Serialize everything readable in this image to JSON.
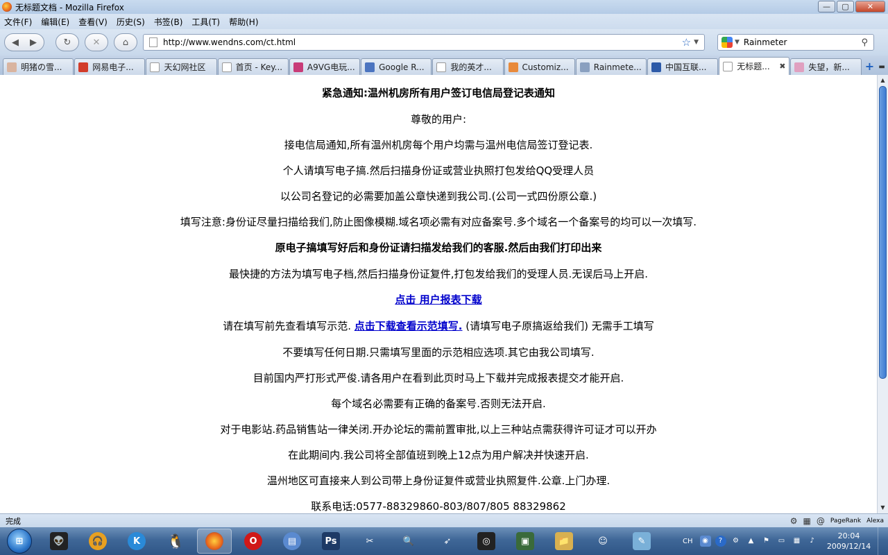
{
  "window": {
    "title": "无标题文档 - Mozilla Firefox",
    "minimize": "—",
    "maximize": "▢",
    "close": "✕"
  },
  "menubar": {
    "items": [
      "文件(F)",
      "编辑(E)",
      "查看(V)",
      "历史(S)",
      "书签(B)",
      "工具(T)",
      "帮助(H)"
    ]
  },
  "toolbar": {
    "back": "◀",
    "forward": "▶",
    "reload": "↻",
    "stop": "✕",
    "home": "⌂",
    "url": "http://www.wendns.com/ct.html",
    "search_value": "Rainmeter"
  },
  "tabs": [
    {
      "label": "明猪の雪...",
      "icon_color": "#d9b4a0"
    },
    {
      "label": "网易电子...",
      "icon_color": "#d23c2a"
    },
    {
      "label": "天幻网社区",
      "icon_color": "#ffffff"
    },
    {
      "label": "首页 - Key...",
      "icon_color": "#ffffff"
    },
    {
      "label": "A9VG电玩...",
      "icon_color": "#c83c78"
    },
    {
      "label": "Google R...",
      "icon_color": "#4b74c0"
    },
    {
      "label": "我的英才...",
      "icon_color": "#ffffff"
    },
    {
      "label": "Customiz...",
      "icon_color": "#e88a3c"
    },
    {
      "label": "Rainmete...",
      "icon_color": "#8aa0c0"
    },
    {
      "label": "中国互联...",
      "icon_color": "#2d5aa8"
    },
    {
      "label": "无标题...",
      "icon_color": "#ffffff",
      "active": true
    },
    {
      "label": "失望，新...",
      "icon_color": "#e0a0c0"
    }
  ],
  "content": {
    "lines": [
      "紧急通知:温州机房所有用户签订电信局登记表通知",
      "尊敬的用户:",
      "接电信局通知,所有温州机房每个用户均需与温州电信局签订登记表.",
      "个人请填写电子搞.然后扫描身份证或营业执照打包发给QQ受理人员",
      "以公司名登记的必需要加盖公章快递到我公司.(公司一式四份原公章.)",
      "填写注意:身份证尽量扫描给我们,防止图像模糊.域名项必需有对应备案号.多个域名一个备案号的均可以一次填写.",
      "原电子搞填写好后和身份证请扫描发给我们的客服.然后由我们打印出来",
      "最快捷的方法为填写电子档,然后扫描身份证复件,打包发给我们的受理人员.无误后马上开启."
    ],
    "download_link": "点击 用户报表下载",
    "sample_prefix": "请在填写前先查看填写示范. ",
    "sample_link": "点击下载查看示范填写.",
    "sample_suffix": " (请填写电子原搞返给我们) 无需手工填写",
    "lines2": [
      "不要填写任何日期.只需填写里面的示范相应选项.其它由我公司填写.",
      "目前国内严打形式严俊.请各用户在看到此页时马上下载并完成报表提交才能开启.",
      "每个域名必需要有正确的备案号.否则无法开启.",
      "对于电影站.药品销售站一律关闭.开办论坛的需前置审批,以上三种站点需获得许可证才可以开办",
      "在此期间内.我公司将全部值班到晚上12点为用户解决并快速开启.",
      "温州地区可直接来人到公司带上身份证复件或营业执照复件.公章.上门办理.",
      "联系电话:0577-88329860-803/807/805 88329862"
    ]
  },
  "statusbar": {
    "text": "完成",
    "pagerank": "PageRank",
    "alexa": "Alexa"
  },
  "taskbar": {
    "lang": "CH",
    "time": "20:04",
    "date": "2009/12/14",
    "apps": [
      {
        "name": "alien-app",
        "glyph": "👽",
        "color": "#222"
      },
      {
        "name": "headset-app",
        "glyph": "🎧",
        "color": "#e8a020"
      },
      {
        "name": "k-app",
        "glyph": "K",
        "color": "#2a8ad8"
      },
      {
        "name": "qq-app",
        "glyph": "🐧",
        "color": "#111"
      },
      {
        "name": "firefox-app",
        "glyph": "🦊",
        "color": "#e8631a",
        "active": true
      },
      {
        "name": "opera-app",
        "glyph": "O",
        "color": "#d01818"
      },
      {
        "name": "archive-app",
        "glyph": "▤",
        "color": "#5a8ad0"
      },
      {
        "name": "photoshop-app",
        "glyph": "Ps",
        "color": "#1d3a66"
      },
      {
        "name": "tools-app",
        "glyph": "✂",
        "color": "#3a78c0"
      },
      {
        "name": "search-app",
        "glyph": "🔍",
        "color": "#6a9ad0"
      },
      {
        "name": "bird-app",
        "glyph": "➶",
        "color": "#3a8ad8"
      },
      {
        "name": "raysource-app",
        "glyph": "◎",
        "color": "#222"
      },
      {
        "name": "monitor-app",
        "glyph": "▣",
        "color": "#3a6a3a"
      },
      {
        "name": "folder-app",
        "glyph": "📁",
        "color": "#d8b050"
      },
      {
        "name": "person-app",
        "glyph": "☺",
        "color": "#3a9a3a"
      },
      {
        "name": "notepad-app",
        "glyph": "✎",
        "color": "#7ab0d8"
      }
    ]
  }
}
